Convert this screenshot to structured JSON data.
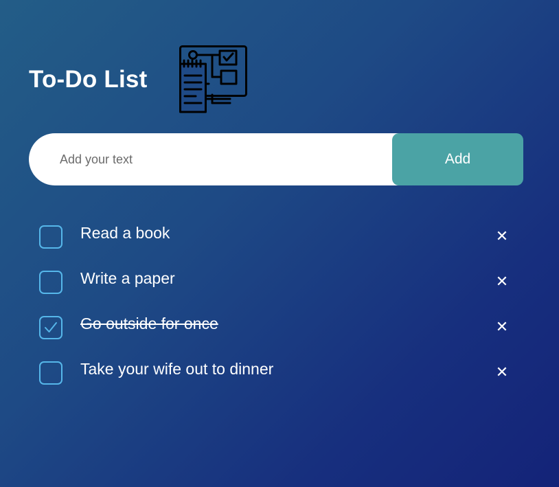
{
  "header": {
    "title": "To-Do List",
    "logo_icon": "checklist-flowchart-icon"
  },
  "form": {
    "input_value": "",
    "input_placeholder": "Add your text",
    "add_label": "Add"
  },
  "tasks": [
    {
      "text": "Read a book",
      "done": false
    },
    {
      "text": "Write a paper",
      "done": false
    },
    {
      "text": "Go outside for once",
      "done": true
    },
    {
      "text": "Take your wife out to dinner",
      "done": false
    }
  ],
  "icons": {
    "delete": "close-icon",
    "delete_glyph": "✕",
    "check": "checkmark-icon"
  },
  "colors": {
    "background_start": "#235d87",
    "background_end": "#142378",
    "accent": "#4ba3a5",
    "checkbox_border": "#56b7ea",
    "text": "#ffffff"
  }
}
